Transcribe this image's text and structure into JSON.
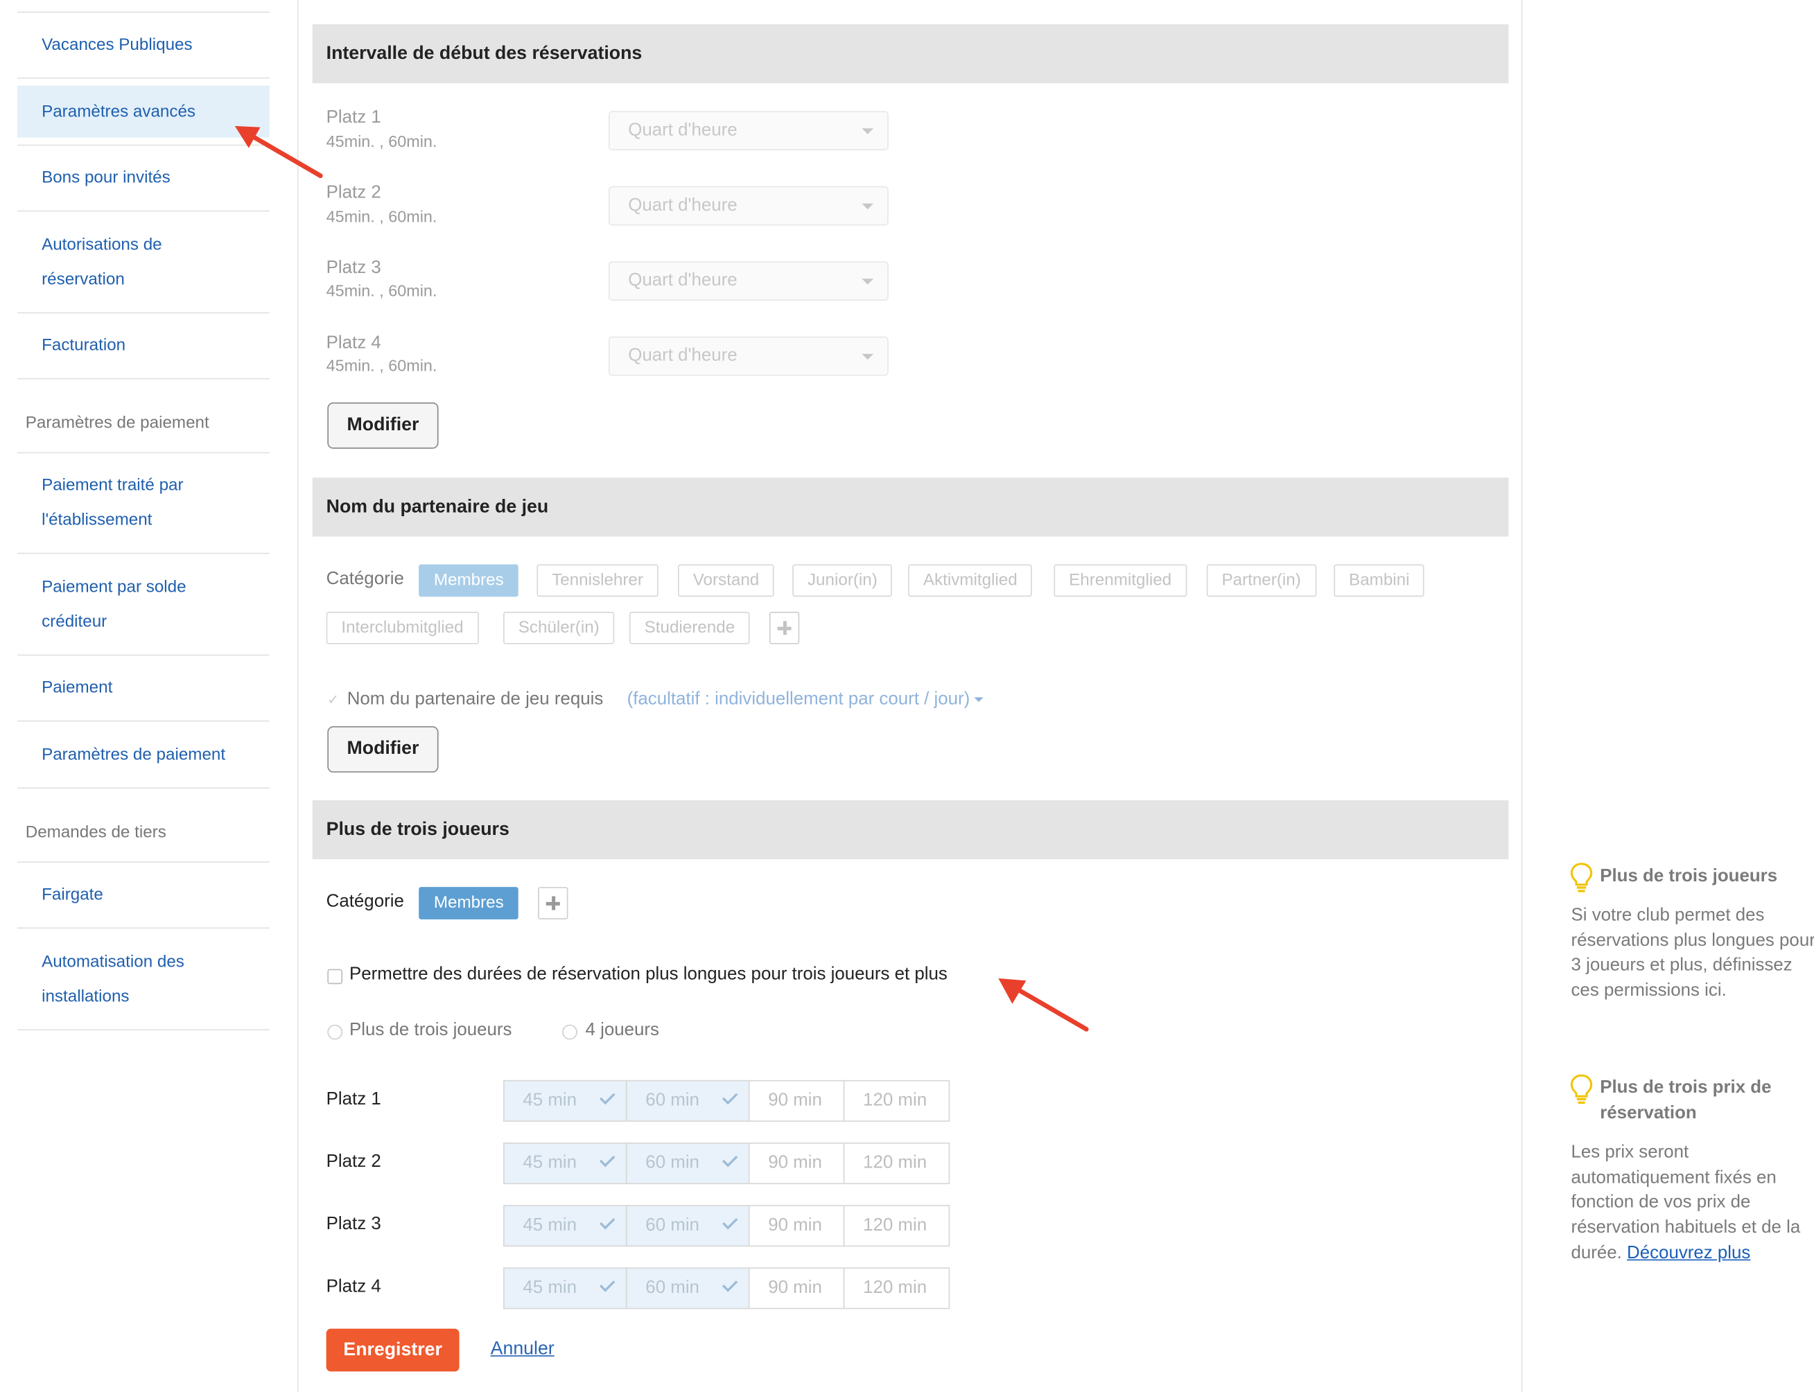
{
  "sidebar": {
    "items": [
      {
        "label": "Vacances Publiques"
      },
      {
        "label": "Paramètres avancés"
      },
      {
        "label": "Bons pour invités"
      },
      {
        "label": "Autorisations de réservation"
      },
      {
        "label": "Facturation"
      },
      {
        "label": "Paiement traité par l'établissement"
      },
      {
        "label": "Paiement par solde créditeur"
      },
      {
        "label": "Paiement"
      },
      {
        "label": "Paramètres de paiement"
      },
      {
        "label": "Fairgate"
      },
      {
        "label": "Automatisation des installations"
      }
    ],
    "heading_payment": "Paramètres de paiement",
    "heading_third_party": "Demandes de tiers"
  },
  "section1": {
    "title": "Intervalle de début des réservations",
    "courts": [
      {
        "name": "Platz 1",
        "durations": "45min. , 60min.",
        "interval": "Quart d'heure"
      },
      {
        "name": "Platz 2",
        "durations": "45min. , 60min.",
        "interval": "Quart d'heure"
      },
      {
        "name": "Platz 3",
        "durations": "45min. , 60min.",
        "interval": "Quart d'heure"
      },
      {
        "name": "Platz 4",
        "durations": "45min. , 60min.",
        "interval": "Quart d'heure"
      }
    ],
    "modify_label": "Modifier"
  },
  "section2": {
    "title": "Nom du partenaire de jeu",
    "category_label": "Catégorie",
    "categories": [
      "Membres",
      "Tennislehrer",
      "Vorstand",
      "Junior(in)",
      "Aktivmitglied",
      "Ehrenmitglied",
      "Partner(in)",
      "Bambini",
      "Interclubmitglied",
      "Schüler(in)",
      "Studierende"
    ],
    "required_label": "Nom du partenaire de jeu requis",
    "optional_link": "(facultatif : individuellement par court / jour)",
    "modify_label": "Modifier"
  },
  "section3": {
    "title": "Plus de trois joueurs",
    "category_label": "Catégorie",
    "category_selected": "Membres",
    "allow_longer_label": "Permettre des durées de réservation plus longues pour trois joueurs et plus",
    "radio_option1": "Plus de trois joueurs",
    "radio_option2": "4 joueurs",
    "courts": [
      {
        "name": "Platz 1"
      },
      {
        "name": "Platz 2"
      },
      {
        "name": "Platz 3"
      },
      {
        "name": "Platz 4"
      }
    ],
    "durations": [
      "45 min",
      "60 min",
      "90 min",
      "120 min"
    ],
    "durations_checked": [
      true,
      true,
      false,
      false
    ],
    "save_label": "Enregistrer",
    "cancel_label": "Annuler"
  },
  "tips": {
    "tip1_title": "Plus de trois joueurs",
    "tip1_body": "Si votre club permet des réservations plus longues pour 3 joueurs et plus, définissez ces permissions ici.",
    "tip2_title": "Plus de trois prix de réservation",
    "tip2_body": "Les prix seront automatiquement fixés en fonction de vos prix de réservation habituels et de la durée.",
    "tip2_link": "Découvrez plus"
  },
  "colors": {
    "accent_blue": "#1f5fae",
    "save_orange": "#ef5a2e",
    "arrow_red": "#e8402b",
    "chip_selected": "#5d9fd3"
  }
}
